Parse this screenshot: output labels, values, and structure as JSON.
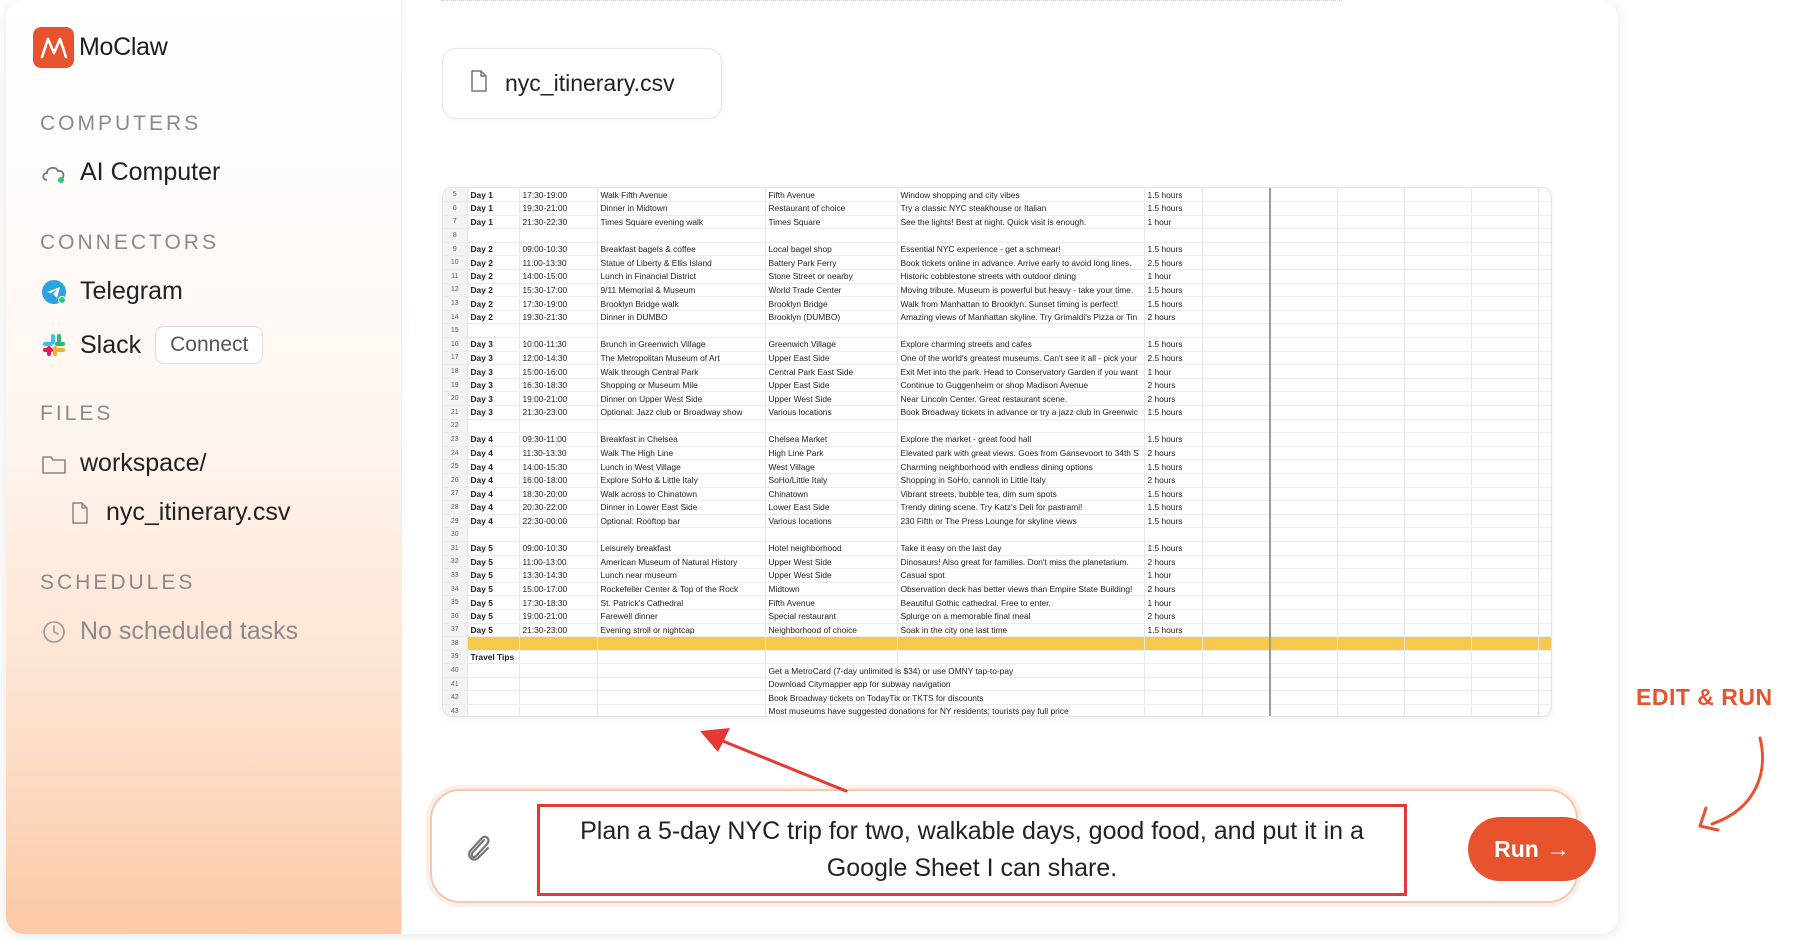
{
  "app": {
    "name": "MoClaw"
  },
  "sidebar": {
    "computers_title": "COMPUTERS",
    "computer_item": "AI Computer",
    "connectors_title": "CONNECTORS",
    "telegram": "Telegram",
    "slack": "Slack",
    "connect": "Connect",
    "files_title": "FILES",
    "folder": "workspace/",
    "file": "nyc_itinerary.csv",
    "schedules_title": "SCHEDULES",
    "no_schedules": "No scheduled tasks"
  },
  "main": {
    "attachment_name": "nyc_itinerary.csv",
    "prompt": "Plan a 5-day NYC trip for two, walkable days, good food, and put it in a Google Sheet I can share.",
    "run_label": "Run",
    "run_arrow": "→"
  },
  "annotation": {
    "label": "EDIT & RUN"
  },
  "colors": {
    "accent": "#e8532d",
    "highlight_row": "#f5c94c",
    "annotation_box": "#e53935"
  },
  "sheet": {
    "rows": [
      [
        "5",
        "Day 1",
        "17:30-19:00",
        "Walk Fifth Avenue",
        "Fifth Avenue",
        "Window shopping and city vibes",
        "1.5 hours"
      ],
      [
        "6",
        "Day 1",
        "19:30-21:00",
        "Dinner in Midtown",
        "Restaurant of choice",
        "Try a classic NYC steakhouse or Italian",
        "1.5 hours"
      ],
      [
        "7",
        "Day 1",
        "21:30-22:30",
        "Times Square evening walk",
        "Times Square",
        "See the lights! Best at night. Quick visit is enough.",
        "1 hour"
      ],
      [
        "8",
        "",
        "",
        "",
        "",
        "",
        ""
      ],
      [
        "9",
        "Day 2",
        "09:00-10:30",
        "Breakfast bagels & coffee",
        "Local bagel shop",
        "Essential NYC experience - get a schmear!",
        "1.5 hours"
      ],
      [
        "10",
        "Day 2",
        "11:00-13:30",
        "Statue of Liberty & Ellis Island",
        "Battery Park Ferry",
        "Book tickets online in advance. Arrive early to avoid long lines.",
        "2.5 hours"
      ],
      [
        "11",
        "Day 2",
        "14:00-15:00",
        "Lunch in Financial District",
        "Stone Street or nearby",
        "Historic cobblestone streets with outdoor dining",
        "1 hour"
      ],
      [
        "12",
        "Day 2",
        "15:30-17:00",
        "9/11 Memorial & Museum",
        "World Trade Center",
        "Moving tribute. Museum is powerful but heavy - take your time.",
        "1.5 hours"
      ],
      [
        "13",
        "Day 2",
        "17:30-19:00",
        "Brooklyn Bridge walk",
        "Brooklyn Bridge",
        "Walk from Manhattan to Brooklyn. Sunset timing is perfect!",
        "1.5 hours"
      ],
      [
        "14",
        "Day 2",
        "19:30-21:30",
        "Dinner in DUMBO",
        "Brooklyn (DUMBO)",
        "Amazing views of Manhattan skyline. Try Grimaldi's Pizza or Tin",
        "2 hours"
      ],
      [
        "15",
        "",
        "",
        "",
        "",
        "",
        ""
      ],
      [
        "16",
        "Day 3",
        "10:00-11:30",
        "Brunch in Greenwich Village",
        "Greenwich Village",
        "Explore charming streets and cafes",
        "1.5 hours"
      ],
      [
        "17",
        "Day 3",
        "12:00-14:30",
        "The Metropolitan Museum of Art",
        "Upper East Side",
        "One of the world's greatest museums. Can't see it all - pick your",
        "2.5 hours"
      ],
      [
        "18",
        "Day 3",
        "15:00-16:00",
        "Walk through Central Park",
        "Central Park East Side",
        "Exit Met into the park. Head to Conservatory Garden if you want",
        "1 hour"
      ],
      [
        "19",
        "Day 3",
        "16:30-18:30",
        "Shopping or Museum Mile",
        "Upper East Side",
        "Continue to Guggenheim or shop Madison Avenue",
        "2 hours"
      ],
      [
        "20",
        "Day 3",
        "19:00-21:00",
        "Dinner on Upper West Side",
        "Upper West Side",
        "Near Lincoln Center. Great restaurant scene.",
        "2 hours"
      ],
      [
        "21",
        "Day 3",
        "21:30-23:00",
        "Optional: Jazz club or Broadway show",
        "Various locations",
        "Book Broadway tickets in advance or try a jazz club in Greenwic",
        "1.5 hours"
      ],
      [
        "22",
        "",
        "",
        "",
        "",
        "",
        ""
      ],
      [
        "23",
        "Day 4",
        "09:30-11:00",
        "Breakfast in Chelsea",
        "Chelsea Market",
        "Explore the market - great food hall",
        "1.5 hours"
      ],
      [
        "24",
        "Day 4",
        "11:30-13:30",
        "Walk The High Line",
        "High Line Park",
        "Elevated park with great views. Goes from Gansevoort to 34th S",
        "2 hours"
      ],
      [
        "25",
        "Day 4",
        "14:00-15:30",
        "Lunch in West Village",
        "West Village",
        "Charming neighborhood with endless dining options",
        "1.5 hours"
      ],
      [
        "26",
        "Day 4",
        "16:00-18:00",
        "Explore SoHo & Little Italy",
        "SoHo/Little Italy",
        "Shopping in SoHo, cannoli in Little Italy",
        "2 hours"
      ],
      [
        "27",
        "Day 4",
        "18:30-20:00",
        "Walk across to Chinatown",
        "Chinatown",
        "Vibrant streets, bubble tea, dim sum spots",
        "1.5 hours"
      ],
      [
        "28",
        "Day 4",
        "20:30-22:00",
        "Dinner in Lower East Side",
        "Lower East Side",
        "Trendy dining scene. Try Katz's Deli for pastrami!",
        "1.5 hours"
      ],
      [
        "29",
        "Day 4",
        "22:30-00:00",
        "Optional: Rooftop bar",
        "Various locations",
        "230 Fifth or The Press Lounge for skyline views",
        "1.5 hours"
      ],
      [
        "30",
        "",
        "",
        "",
        "",
        "",
        ""
      ],
      [
        "31",
        "Day 5",
        "09:00-10:30",
        "Leisurely breakfast",
        "Hotel neighborhood",
        "Take it easy on the last day",
        "1.5 hours"
      ],
      [
        "32",
        "Day 5",
        "11:00-13:00",
        "American Museum of Natural History",
        "Upper West Side",
        "Dinosaurs! Also great for families. Don't miss the planetarium.",
        "2 hours"
      ],
      [
        "33",
        "Day 5",
        "13:30-14:30",
        "Lunch near museum",
        "Upper West Side",
        "Casual spot",
        "1 hour"
      ],
      [
        "34",
        "Day 5",
        "15:00-17:00",
        "Rockefeller Center & Top of the Rock",
        "Midtown",
        "Observation deck has better views than Empire State Building!",
        "2 hours"
      ],
      [
        "35",
        "Day 5",
        "17:30-18:30",
        "St. Patrick's Cathedral",
        "Fifth Avenue",
        "Beautiful Gothic cathedral. Free to enter.",
        "1 hour"
      ],
      [
        "36",
        "Day 5",
        "19:00-21:00",
        "Farewell dinner",
        "Special restaurant",
        "Splurge on a memorable final meal",
        "2 hours"
      ],
      [
        "37",
        "Day 5",
        "21:30-23:00",
        "Evening stroll or nightcap",
        "Neighborhood of choice",
        "Soak in the city one last time",
        "1.5 hours"
      ],
      [
        "38",
        "",
        "",
        "",
        "",
        "",
        ""
      ],
      [
        "39",
        "Travel Tips",
        "",
        "",
        "",
        "",
        ""
      ],
      [
        "40",
        "",
        "",
        "",
        "Get a MetroCard (7-day unlimited is $34) or use OMNY tap-to-pay",
        "",
        ""
      ],
      [
        "41",
        "",
        "",
        "",
        "Download Citymapper app for subway navigation",
        "",
        ""
      ],
      [
        "42",
        "",
        "",
        "",
        "Book Broadway tickets on TodayTix or TKTS for discounts",
        "",
        ""
      ],
      [
        "43",
        "",
        "",
        "",
        "Most museums have suggested donations for NY residents; tourists pay full price",
        "",
        ""
      ]
    ],
    "highlight_row": "38"
  }
}
